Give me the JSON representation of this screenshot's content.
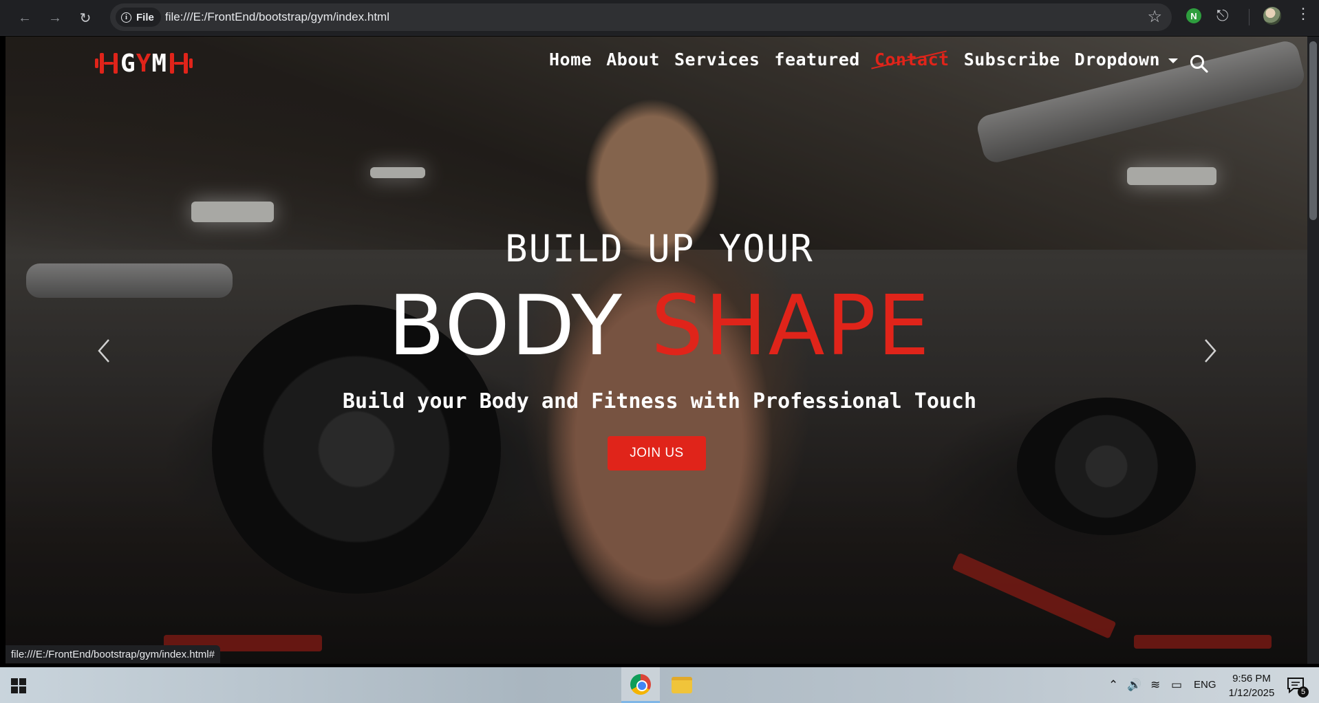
{
  "browser": {
    "file_chip_label": "File",
    "url": "file:///E:/FrontEnd/bootstrap/gym/index.html",
    "extension_badge": "N",
    "status_url": "file:///E:/FrontEnd/bootstrap/gym/index.html#"
  },
  "site": {
    "logo": {
      "text_before": "G",
      "text_accent": "Y",
      "text_after": "M"
    },
    "nav": [
      {
        "label": "Home"
      },
      {
        "label": "About"
      },
      {
        "label": "Services"
      },
      {
        "label": "featured"
      },
      {
        "label": "Contact",
        "active": true
      },
      {
        "label": "Subscribe"
      },
      {
        "label": "Dropdown"
      }
    ],
    "accent_color": "#e0241a"
  },
  "hero": {
    "line1": "BUILD UP YOUR",
    "line2_white": "BODY",
    "line2_red": "SHAPE",
    "subtitle": "Build your Body and Fitness with Professional Touch",
    "cta_label": "JOIN US"
  },
  "taskbar": {
    "language": "ENG",
    "time": "9:56 PM",
    "date": "1/12/2025",
    "notification_count": "5"
  }
}
